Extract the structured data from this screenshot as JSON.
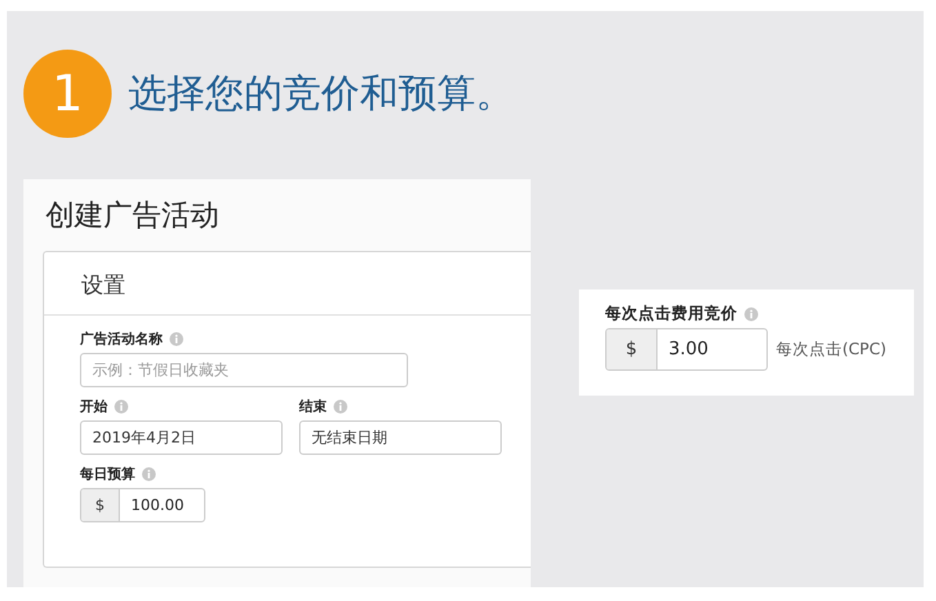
{
  "step": {
    "number": "1",
    "title": "选择您的竞价和预算。"
  },
  "campaign_form": {
    "title": "创建广告活动",
    "section_title": "设置",
    "name_field": {
      "label": "广告活动名称",
      "placeholder": "示例：节假日收藏夹"
    },
    "start_field": {
      "label": "开始",
      "value": "2019年4月2日"
    },
    "end_field": {
      "label": "结束",
      "value": "无结束日期"
    },
    "budget_field": {
      "label": "每日预算",
      "prefix": "$",
      "value": "100.00"
    }
  },
  "bid_card": {
    "label": "每次点击费用竞价",
    "prefix": "$",
    "value": "3.00",
    "suffix": "每次点击(CPC)"
  }
}
